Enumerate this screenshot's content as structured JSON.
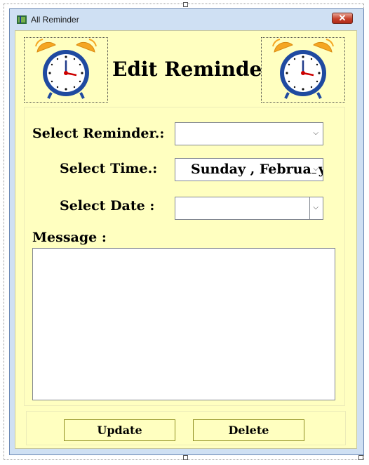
{
  "window": {
    "title": "All Reminder",
    "close_glyph": "✕"
  },
  "header": {
    "title": "Edit Reminder",
    "left_icon": "alarm-clock-icon",
    "right_icon": "alarm-clock-icon"
  },
  "form": {
    "reminder_label": "Select Reminder.:",
    "reminder_value": "",
    "time_label": "Select Time.:",
    "time_value": "Sunday    ,  February",
    "date_label": "Select Date :",
    "date_value": "",
    "message_label": "Message :",
    "message_value": "",
    "dropdown_glyph": "⌵"
  },
  "buttons": {
    "update": "Update",
    "delete": "Delete"
  },
  "colors": {
    "client_bg": "#ffffc0",
    "frame": "#cfe0f3",
    "clock_ring": "#1f4aa0",
    "bells": "#f5a623",
    "hands": "#cc0000"
  }
}
